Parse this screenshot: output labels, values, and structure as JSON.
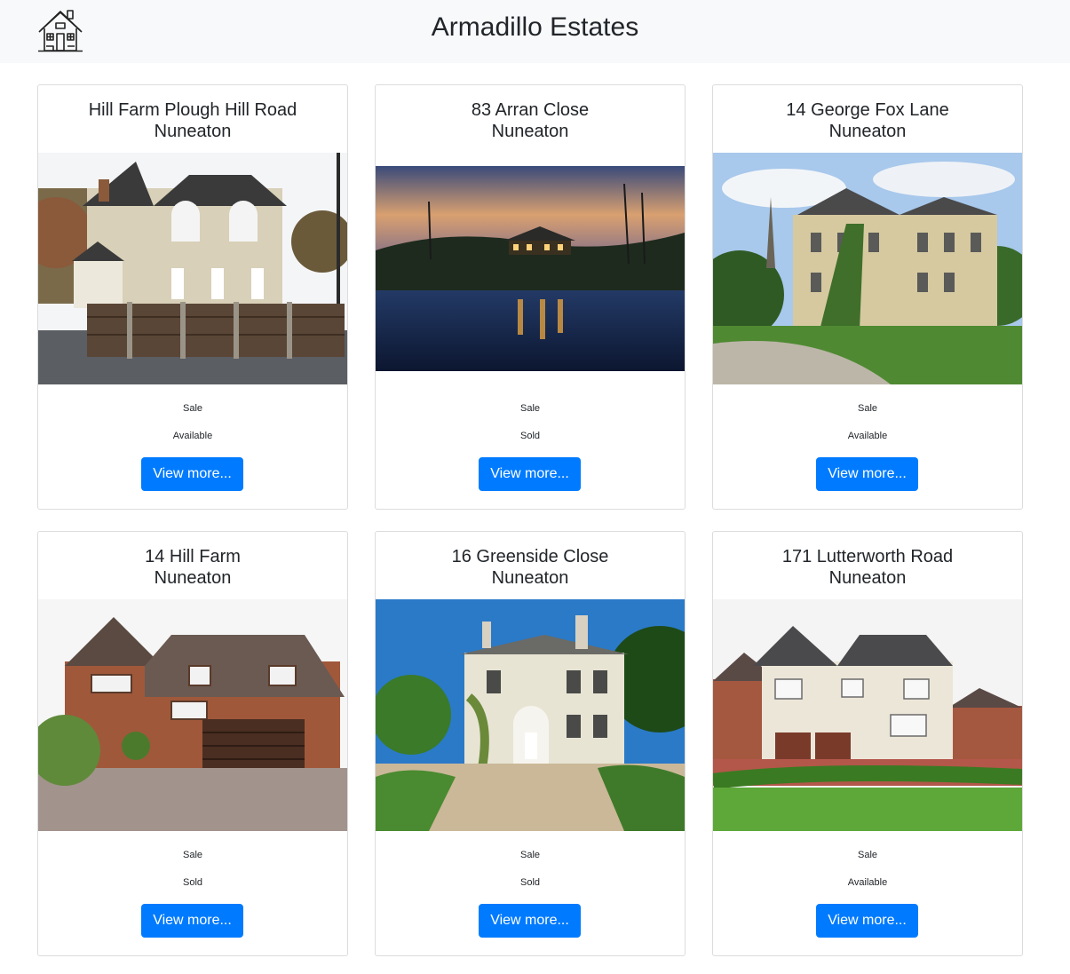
{
  "header": {
    "title": "Armadillo Estates",
    "logo_icon": "house-icon"
  },
  "accent_color": "#007bff",
  "listings": [
    {
      "address": "Hill Farm Plough Hill Road",
      "town": "Nuneaton",
      "type": "Sale",
      "status": "Available",
      "button_label": "View more...",
      "image": "brick-semi-detached-house-photo"
    },
    {
      "address": "83 Arran Close",
      "town": "Nuneaton",
      "type": "Sale",
      "status": "Sold",
      "button_label": "View more...",
      "image": "lakeside-house-at-dusk-photo"
    },
    {
      "address": "14 George Fox Lane",
      "town": "Nuneaton",
      "type": "Sale",
      "status": "Available",
      "button_label": "View more...",
      "image": "victorian-stone-mansion-photo"
    },
    {
      "address": "14 Hill Farm",
      "town": "Nuneaton",
      "type": "Sale",
      "status": "Sold",
      "button_label": "View more...",
      "image": "detached-brick-house-with-garage-photo"
    },
    {
      "address": "16 Greenside Close",
      "town": "Nuneaton",
      "type": "Sale",
      "status": "Sold",
      "button_label": "View more...",
      "image": "villa-with-gravel-drive-photo"
    },
    {
      "address": "171 Lutterworth Road",
      "town": "Nuneaton",
      "type": "Sale",
      "status": "Available",
      "button_label": "View more...",
      "image": "white-render-house-with-lawn-photo"
    }
  ]
}
